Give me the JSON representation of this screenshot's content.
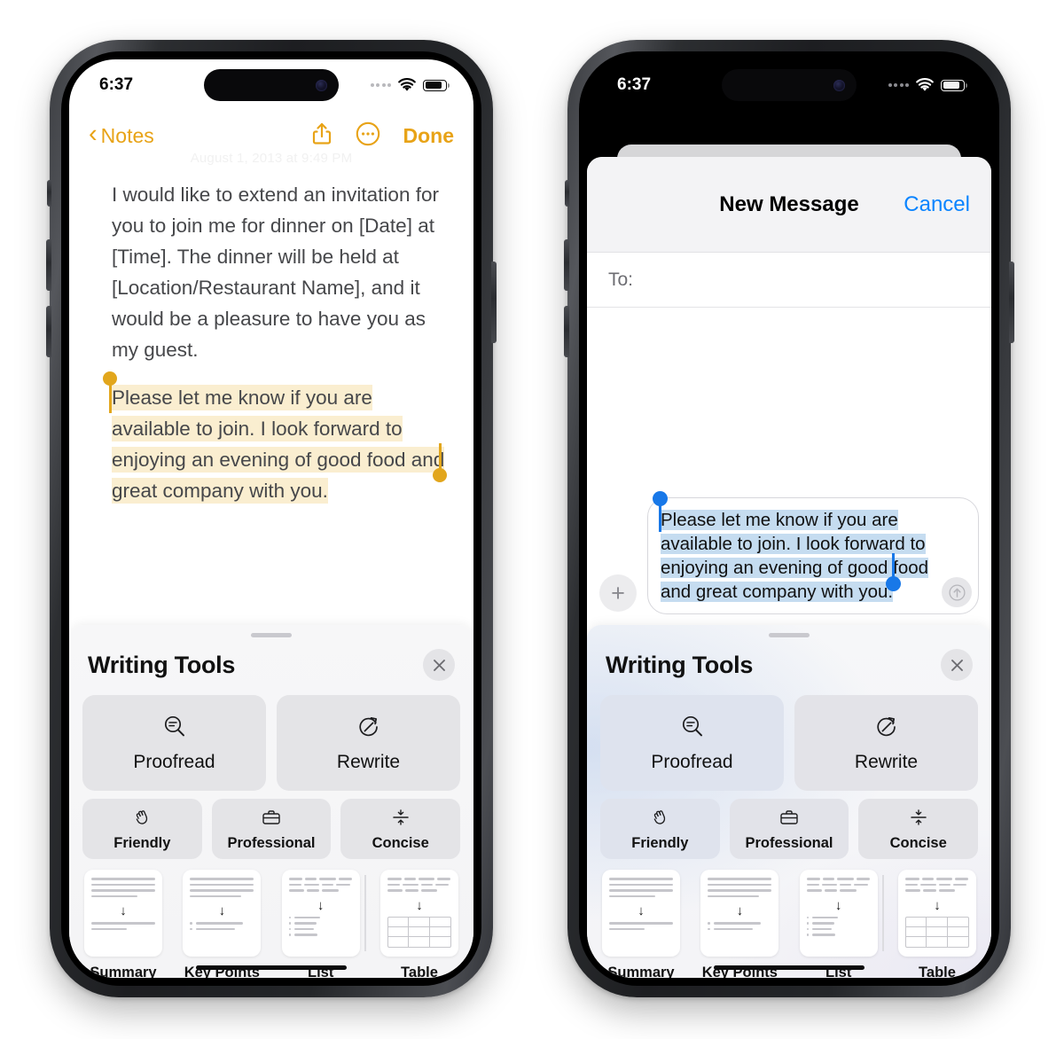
{
  "status_bar": {
    "time": "6:37",
    "wifi_icon": "wifi-icon",
    "battery_icon": "battery-icon",
    "cellular_icon": "cellular-dots-icon"
  },
  "left_phone": {
    "app": "Notes",
    "nav": {
      "back_label": "Notes",
      "back_icon": "chevron-left-icon",
      "share_icon": "share-icon",
      "more_icon": "ellipsis-circle-icon",
      "done_label": "Done"
    },
    "note": {
      "date": "August 1, 2013 at 9:49 PM",
      "paragraph_1": "I would like to extend an invitation for you to join me for dinner on [Date] at [Time]. The dinner will be held at [Location/Restaurant Name], and it would be a pleasure to have you as my guest.",
      "selected_text": "Please let me know if you are available to join. I look forward to enjoying an evening of good food and great company with you.",
      "selection_color": "#E2A61C",
      "highlight_color": "#faeed0"
    }
  },
  "right_phone": {
    "app": "Messages",
    "sheet": {
      "title": "New Message",
      "cancel_label": "Cancel",
      "to_label": "To:",
      "cancel_color": "#0a84ff"
    },
    "composer": {
      "plus_icon": "plus-icon",
      "send_icon": "send-arrow-up-icon",
      "message_text": "Please let me know if you are available to join. I look forward to enjoying an evening of good food and great company with you.",
      "selection_color": "#1878e8",
      "highlight_color": "#c5dcf0"
    }
  },
  "writing_tools": {
    "title": "Writing Tools",
    "close_icon": "close-icon",
    "grabber": "sheet-grabber",
    "main_actions": [
      {
        "label": "Proofread",
        "icon": "magnifier-lines-icon"
      },
      {
        "label": "Rewrite",
        "icon": "rewrite-circle-arrow-icon"
      }
    ],
    "tone_actions": [
      {
        "label": "Friendly",
        "icon": "waving-hand-icon"
      },
      {
        "label": "Professional",
        "icon": "briefcase-icon"
      },
      {
        "label": "Concise",
        "icon": "compress-arrows-icon"
      }
    ],
    "format_actions": [
      {
        "label": "Summary",
        "icon": "summary-card-icon"
      },
      {
        "label": "Key Points",
        "icon": "key-points-card-icon"
      },
      {
        "label": "List",
        "icon": "list-card-icon"
      },
      {
        "label": "Table",
        "icon": "table-card-icon"
      }
    ]
  }
}
